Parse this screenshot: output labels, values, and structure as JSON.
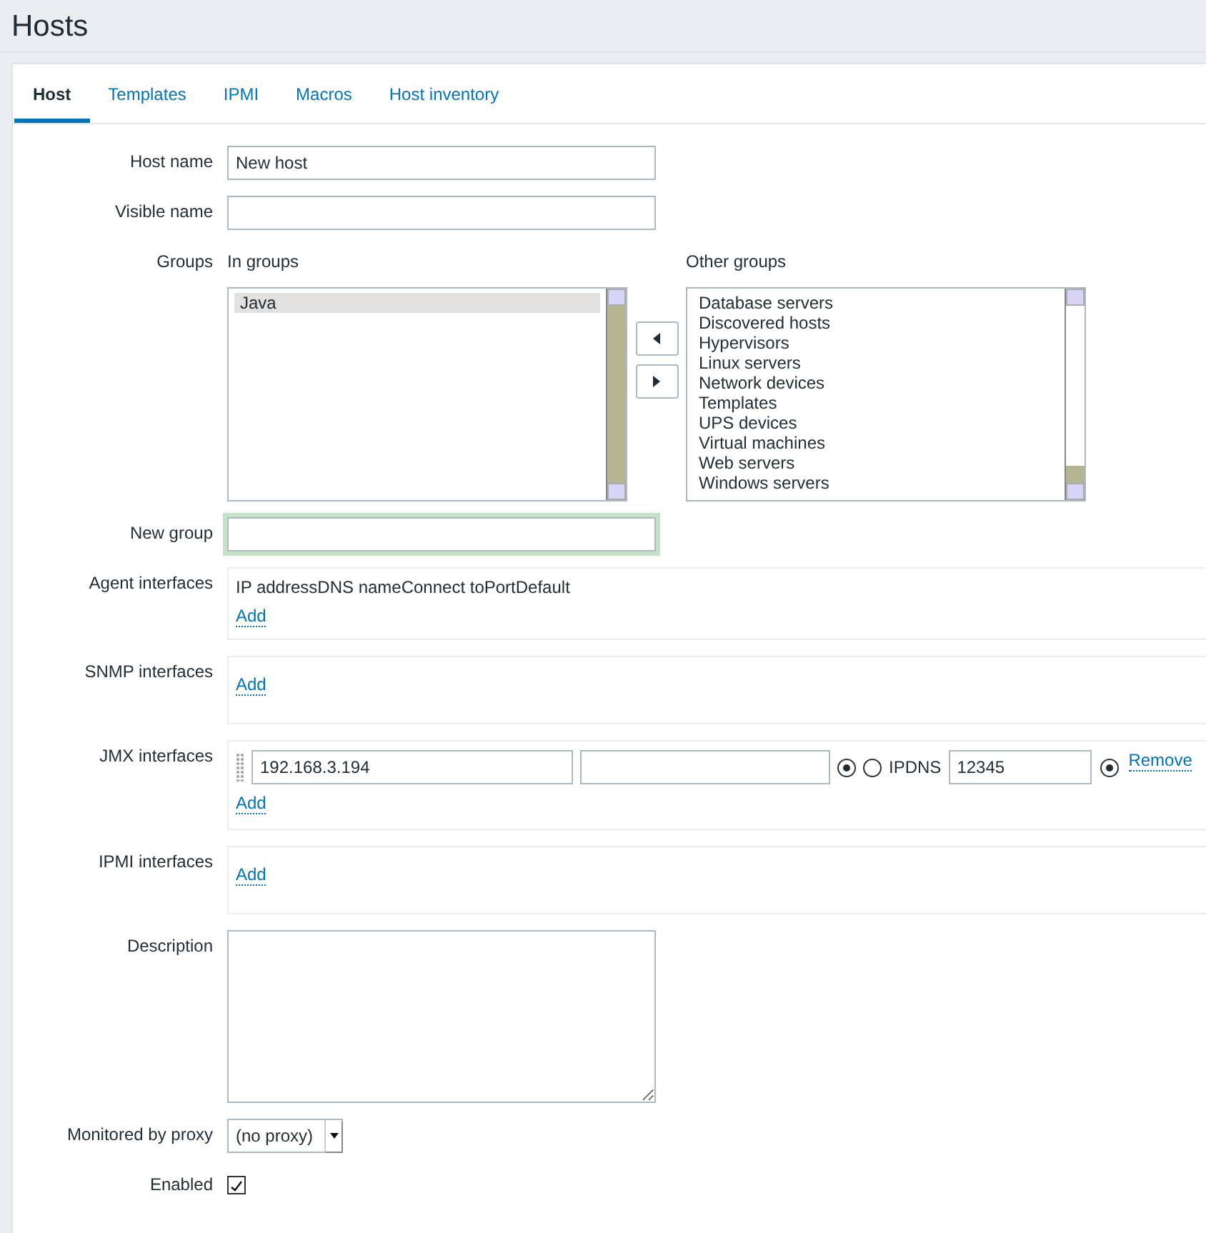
{
  "page_title": "Hosts",
  "tabs": [
    {
      "label": "Host",
      "selected": true
    },
    {
      "label": "Templates",
      "selected": false
    },
    {
      "label": "IPMI",
      "selected": false
    },
    {
      "label": "Macros",
      "selected": false
    },
    {
      "label": "Host inventory",
      "selected": false
    }
  ],
  "host_name": {
    "label": "Host name",
    "value": "New host"
  },
  "visible_name": {
    "label": "Visible name"
  },
  "groups": {
    "label": "Groups",
    "in_groups": {
      "title": "In groups",
      "items": [
        {
          "label": "Java",
          "selected": true
        }
      ]
    },
    "other_groups": {
      "title": "Other groups",
      "items": [
        {
          "label": "Database servers",
          "selected": false
        },
        {
          "label": "Discovered hosts",
          "selected": false
        },
        {
          "label": "Hypervisors",
          "selected": false
        },
        {
          "label": "Linux servers",
          "selected": false
        },
        {
          "label": "Network devices",
          "selected": false
        },
        {
          "label": "Templates",
          "selected": false
        },
        {
          "label": "UPS devices",
          "selected": false
        },
        {
          "label": "Virtual machines",
          "selected": false
        },
        {
          "label": "Web servers",
          "selected": false
        },
        {
          "label": "Windows servers",
          "selected": false
        }
      ]
    }
  },
  "new_group": {
    "label": "New group",
    "focused": true
  },
  "interfaces": [
    {
      "label": "Agent interfaces",
      "header": "IP addressDNS nameConnect toPortDefault",
      "add": "Add"
    },
    {
      "label": "SNMP interfaces",
      "add": "Add"
    },
    {
      "label": "JMX interfaces",
      "add": "Add",
      "rows": [
        {
          "ip": "192.168.3.194",
          "connect": [
            {
              "selected": true
            },
            {
              "selected": false
            }
          ],
          "connect_label": "IPDNS",
          "port": "12345",
          "default": true,
          "remove": "Remove"
        }
      ]
    },
    {
      "label": "IPMI interfaces",
      "add": "Add"
    }
  ],
  "description": {
    "label": "Description"
  },
  "proxy": {
    "label": "Monitored by proxy",
    "value": "(no proxy)"
  },
  "enabled": {
    "label": "Enabled",
    "checked": true
  }
}
